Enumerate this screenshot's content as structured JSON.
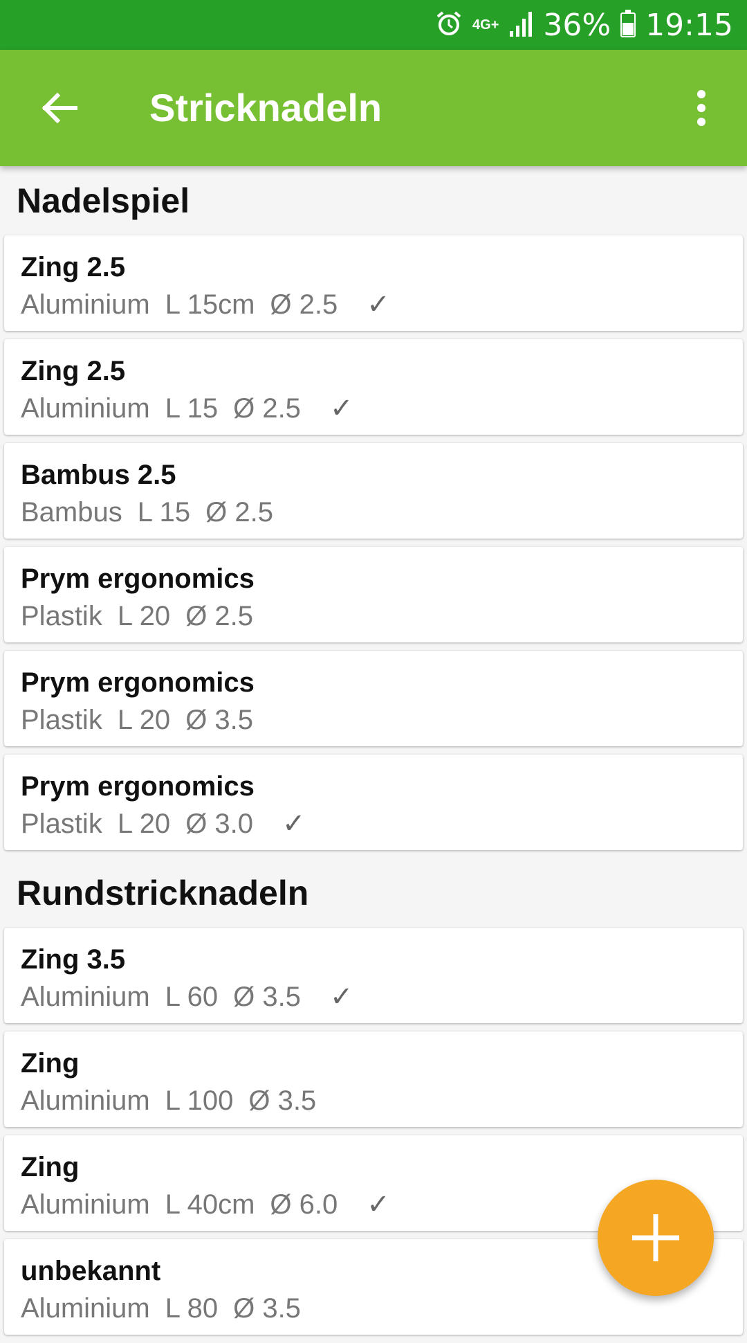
{
  "status_bar": {
    "network": "4G+",
    "battery": "36%",
    "time": "19:15",
    "icons": [
      "alarm-icon",
      "signal-icon",
      "battery-icon"
    ]
  },
  "app_bar": {
    "title": "Stricknadeln",
    "back_icon": "arrow-left-icon",
    "menu_icon": "more-vert-icon",
    "color": "#77bf33"
  },
  "sections": [
    {
      "title": "Nadelspiel",
      "items": [
        {
          "name": "Zing 2.5",
          "material": "Aluminium",
          "length": "L 15cm",
          "diameter": "Ø 2.5",
          "check": "✓"
        },
        {
          "name": "Zing 2.5",
          "material": "Aluminium",
          "length": "L 15",
          "diameter": "Ø 2.5",
          "check": "✓"
        },
        {
          "name": "Bambus 2.5",
          "material": "Bambus",
          "length": "L 15",
          "diameter": "Ø 2.5",
          "check": ""
        },
        {
          "name": "Prym ergonomics",
          "material": "Plastik",
          "length": "L 20",
          "diameter": "Ø 2.5",
          "check": ""
        },
        {
          "name": "Prym ergonomics",
          "material": "Plastik",
          "length": "L 20",
          "diameter": "Ø 3.5",
          "check": ""
        },
        {
          "name": "Prym ergonomics",
          "material": "Plastik",
          "length": "L 20",
          "diameter": "Ø 3.0",
          "check": "✓"
        }
      ]
    },
    {
      "title": "Rundstricknadeln",
      "items": [
        {
          "name": "Zing 3.5",
          "material": "Aluminium",
          "length": "L 60",
          "diameter": "Ø 3.5",
          "check": "✓"
        },
        {
          "name": "Zing",
          "material": "Aluminium",
          "length": "L 100",
          "diameter": "Ø 3.5",
          "check": ""
        },
        {
          "name": "Zing",
          "material": "Aluminium",
          "length": "L 40cm",
          "diameter": "Ø 6.0",
          "check": "✓"
        },
        {
          "name": "unbekannt",
          "material": "Aluminium",
          "length": "L 80",
          "diameter": "Ø 3.5",
          "check": ""
        }
      ]
    }
  ],
  "fab": {
    "icon": "plus-icon",
    "label": "+",
    "color": "#f5a623"
  }
}
